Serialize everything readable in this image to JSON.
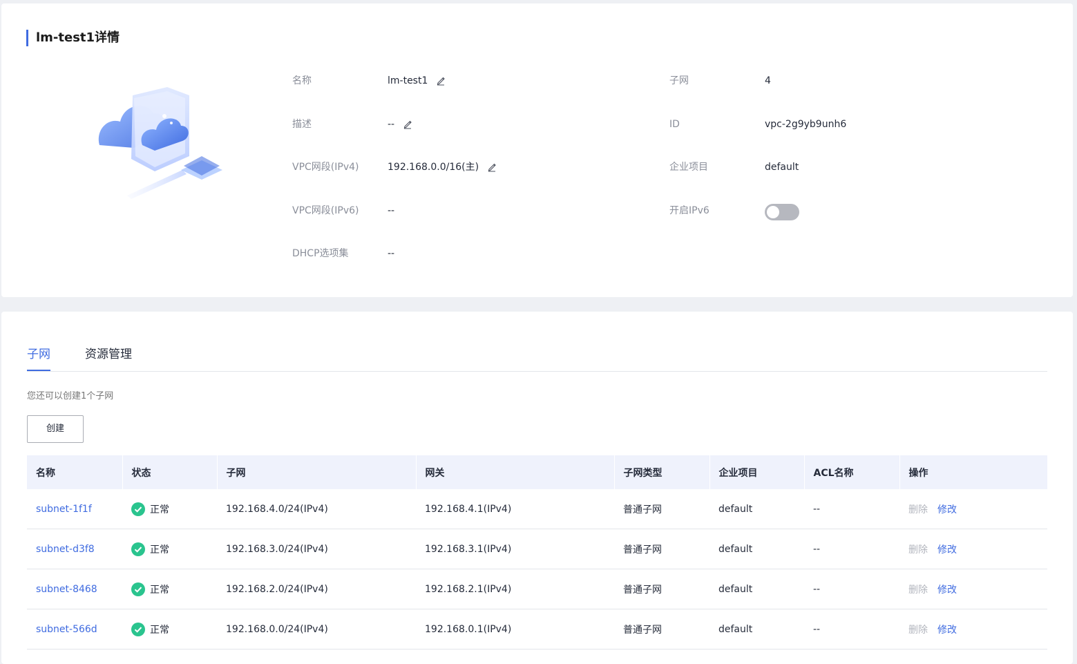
{
  "detail": {
    "title": "lm-test1详情",
    "fields_left": [
      {
        "label": "名称",
        "value": "lm-test1",
        "editable": true
      },
      {
        "label": "描述",
        "value": "--",
        "editable": true
      },
      {
        "label": "VPC网段(IPv4)",
        "value": "192.168.0.0/16(主)",
        "editable": true
      },
      {
        "label": "VPC网段(IPv6)",
        "value": "--",
        "editable": false
      },
      {
        "label": "DHCP选项集",
        "value": "--",
        "editable": false
      }
    ],
    "fields_right": [
      {
        "label": "子网",
        "value": "4"
      },
      {
        "label": "ID",
        "value": "vpc-2g9yb9unh6"
      },
      {
        "label": "企业项目",
        "value": "default"
      },
      {
        "label": "开启IPv6",
        "toggle_on": false
      }
    ]
  },
  "tabs": [
    {
      "label": "子网",
      "active": true
    },
    {
      "label": "资源管理",
      "active": false
    }
  ],
  "subnet_section": {
    "hint": "您还可以创建1个子网",
    "create_label": "创建",
    "columns": [
      "名称",
      "状态",
      "子网",
      "网关",
      "子网类型",
      "企业项目",
      "ACL名称",
      "操作"
    ],
    "rows": [
      {
        "name": "subnet-1f1f",
        "status": "正常",
        "subnet": "192.168.4.0/24(IPv4)",
        "gateway": "192.168.4.1(IPv4)",
        "type": "普通子网",
        "project": "default",
        "acl": "--",
        "delete": "删除",
        "edit": "修改"
      },
      {
        "name": "subnet-d3f8",
        "status": "正常",
        "subnet": "192.168.3.0/24(IPv4)",
        "gateway": "192.168.3.1(IPv4)",
        "type": "普通子网",
        "project": "default",
        "acl": "--",
        "delete": "删除",
        "edit": "修改"
      },
      {
        "name": "subnet-8468",
        "status": "正常",
        "subnet": "192.168.2.0/24(IPv4)",
        "gateway": "192.168.2.1(IPv4)",
        "type": "普通子网",
        "project": "default",
        "acl": "--",
        "delete": "删除",
        "edit": "修改"
      },
      {
        "name": "subnet-566d",
        "status": "正常",
        "subnet": "192.168.0.0/24(IPv4)",
        "gateway": "192.168.0.1(IPv4)",
        "type": "普通子网",
        "project": "default",
        "acl": "--",
        "delete": "删除",
        "edit": "修改"
      }
    ]
  },
  "colors": {
    "accent": "#3f6be0",
    "status_ok": "#2ac48e",
    "toggle_off": "#b6b8bf",
    "header_bg": "#eff2fc"
  }
}
